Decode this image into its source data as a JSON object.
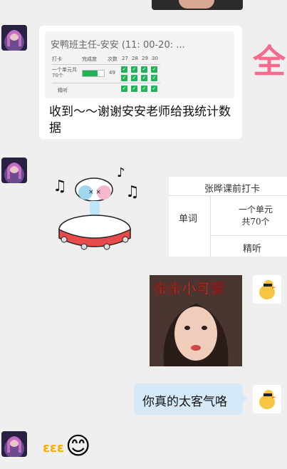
{
  "top_image": {
    "desc": "photo"
  },
  "message1": {
    "quote": {
      "title": "安鸭班主任-安安 (11: 00-20: ...",
      "table": {
        "headers": [
          "打卡",
          "完成度",
          "次数",
          "27",
          "28",
          "29",
          "30"
        ],
        "row1": {
          "label": "一个单元共70个",
          "value": "49"
        },
        "row2": {
          "label": "精听"
        }
      }
    },
    "text": "收到～～谢谢安安老师给我统计数据"
  },
  "right_banner": {
    "char": "全"
  },
  "side_table": {
    "title": "张晔课前打卡",
    "cell_word": "单词",
    "cell_unit": "一个单元\n共70个",
    "cell_listen": "精听"
  },
  "sticker_caption": "亲亲小可爱",
  "message_right": {
    "text": "你真的太客气咯"
  },
  "emoji_reply": {
    "glyph": "😊"
  },
  "colors": {
    "bg": "#efefef",
    "bubble_white": "#ffffff",
    "bubble_blue": "#d6e9f8",
    "check_green": "#22b35a",
    "banner_pink": "#f46b8d"
  }
}
